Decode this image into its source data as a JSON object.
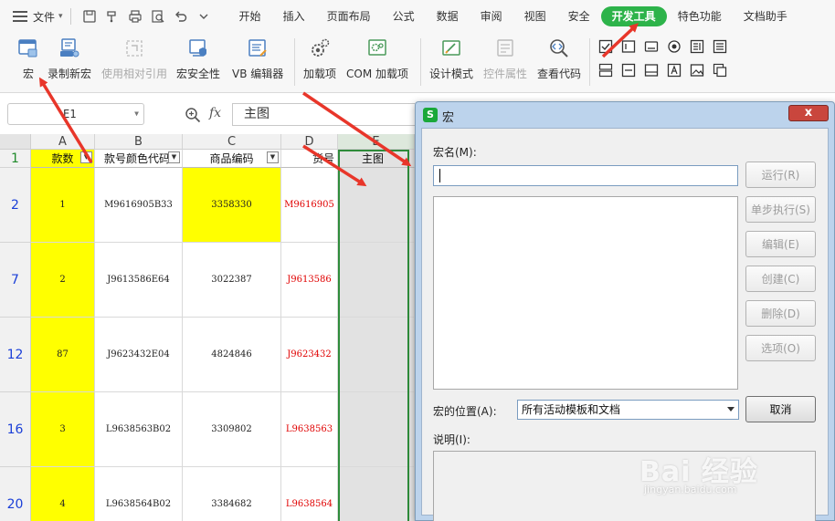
{
  "menubar": {
    "file_label": "文件",
    "tabs": [
      "开始",
      "插入",
      "页面布局",
      "公式",
      "数据",
      "审阅",
      "视图",
      "安全",
      "开发工具",
      "特色功能",
      "文档助手"
    ],
    "active_tab": "开发工具"
  },
  "ribbon": {
    "macro": "宏",
    "record_macro": "录制新宏",
    "relative_ref": "使用相对引用",
    "macro_security": "宏安全性",
    "vb_editor": "VB 编辑器",
    "addins": "加载项",
    "com_addins": "COM 加载项",
    "design_mode": "设计模式",
    "control_props": "控件属性",
    "view_code": "查看代码"
  },
  "formula_bar": {
    "cell_ref": "E1",
    "fx": "fx",
    "content": "主图"
  },
  "sheet": {
    "columns": [
      "A",
      "B",
      "C",
      "D",
      "E"
    ],
    "header_row": "1",
    "headers": [
      "款数",
      "款号颜色代码",
      "商品编码",
      "货号",
      "主图"
    ],
    "rows": [
      {
        "num": "2",
        "a": "1",
        "b": "M9616905B33",
        "c": "3358330",
        "d": "M9616905"
      },
      {
        "num": "7",
        "a": "2",
        "b": "J9613586E64",
        "c": "3022387",
        "d": "J9613586"
      },
      {
        "num": "12",
        "a": "87",
        "b": "J9623432E04",
        "c": "4824846",
        "d": "J9623432"
      },
      {
        "num": "16",
        "a": "3",
        "b": "L9638563B02",
        "c": "3309802",
        "d": "L9638563"
      },
      {
        "num": "20",
        "a": "4",
        "b": "L9638564B02",
        "c": "3384682",
        "d": "L9638564"
      }
    ]
  },
  "dialog": {
    "title": "宏",
    "close": "x",
    "macro_name_label": "宏名(M):",
    "macro_name_value": "",
    "buttons": {
      "run": "运行(R)",
      "step": "单步执行(S)",
      "edit": "编辑(E)",
      "create": "创建(C)",
      "delete": "删除(D)",
      "options": "选项(O)",
      "cancel": "取消"
    },
    "location_label": "宏的位置(A):",
    "location_value": "所有活动模板和文档",
    "description_label": "说明(I):"
  },
  "watermark": {
    "brand": "Bai 经验",
    "url": "jingyan.baidu.com"
  },
  "colors": {
    "active_tab": "#2db34a",
    "highlight_yellow": "#ffff00",
    "arrow_red": "#e8362a",
    "selection_green": "#2e8b3a"
  }
}
